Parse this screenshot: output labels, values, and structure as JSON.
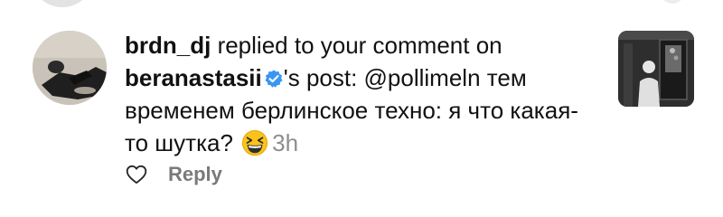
{
  "notification": {
    "actor_username": "brdn_dj",
    "action_text": " replied to your comment on ",
    "post_owner_username": "beranastasii",
    "post_suffix": "'s post: @pollimeln тем временем берлинское техно: я что какая-то шутка? ",
    "emoji_icon": "grinning-squinting-face-icon",
    "timestamp": "3h",
    "verified_icon": "verified-badge-icon",
    "verified_color": "#3897f0",
    "like_icon": "heart-outline-icon",
    "reply_label": "Reply"
  }
}
